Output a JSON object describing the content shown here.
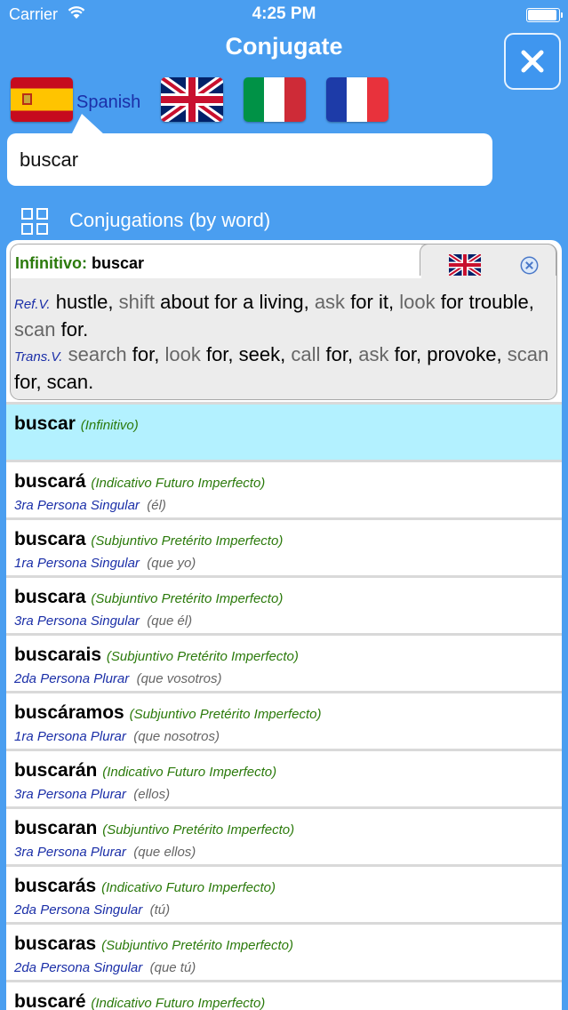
{
  "status_bar": {
    "carrier": "Carrier",
    "time": "4:25 PM"
  },
  "header": {
    "title": "Conjugate"
  },
  "languages": {
    "selected_label": "Spanish",
    "flags": [
      "spain-flag",
      "uk-flag",
      "italy-flag",
      "france-flag"
    ]
  },
  "search": {
    "value": "buscar"
  },
  "section": {
    "title": "Conjugations (by word)"
  },
  "definition": {
    "infinitive_label": "Infinitivo:",
    "infinitive_word": "buscar",
    "ref_label": "Ref.V.",
    "ref_words": [
      "hustle,",
      "shift",
      "about for a living,",
      "ask",
      "for it,",
      "look",
      "for trouble,",
      "scan",
      "for."
    ],
    "trans_label": "Trans.V.",
    "trans_words": [
      "search",
      "for,",
      "look",
      "for, seek,",
      "call",
      "for,",
      "ask",
      "for, provoke,",
      "scan",
      "for, scan."
    ]
  },
  "conjugations": [
    {
      "word": "buscar",
      "tense": "(Infinitivo)",
      "person": "",
      "pronoun": ""
    },
    {
      "word": "buscará",
      "tense": "(Indicativo Futuro Imperfecto)",
      "person": "3ra Persona Singular",
      "pronoun": "(él)"
    },
    {
      "word": "buscara",
      "tense": "(Subjuntivo Pretérito Imperfecto)",
      "person": "1ra Persona Singular",
      "pronoun": "(que yo)"
    },
    {
      "word": "buscara",
      "tense": "(Subjuntivo Pretérito Imperfecto)",
      "person": "3ra Persona Singular",
      "pronoun": "(que él)"
    },
    {
      "word": "buscarais",
      "tense": "(Subjuntivo Pretérito Imperfecto)",
      "person": "2da Persona Plurar",
      "pronoun": "(que vosotros)"
    },
    {
      "word": "buscáramos",
      "tense": "(Subjuntivo Pretérito Imperfecto)",
      "person": "1ra Persona Plurar",
      "pronoun": "(que nosotros)"
    },
    {
      "word": "buscarán",
      "tense": "(Indicativo Futuro Imperfecto)",
      "person": "3ra Persona Plurar",
      "pronoun": "(ellos)"
    },
    {
      "word": "buscaran",
      "tense": "(Subjuntivo Pretérito Imperfecto)",
      "person": "3ra Persona Plurar",
      "pronoun": "(que ellos)"
    },
    {
      "word": "buscarás",
      "tense": "(Indicativo Futuro Imperfecto)",
      "person": "2da Persona Singular",
      "pronoun": "(tú)"
    },
    {
      "word": "buscaras",
      "tense": "(Subjuntivo Pretérito Imperfecto)",
      "person": "2da Persona Singular",
      "pronoun": "(que tú)"
    },
    {
      "word": "buscaré",
      "tense": "(Indicativo Futuro Imperfecto)",
      "person": "",
      "pronoun": ""
    }
  ],
  "colors": {
    "background": "#4a9ef0",
    "selected_row": "#b3f1ff",
    "tense_green": "#2b7a0b",
    "person_blue": "#1b2fa8"
  }
}
